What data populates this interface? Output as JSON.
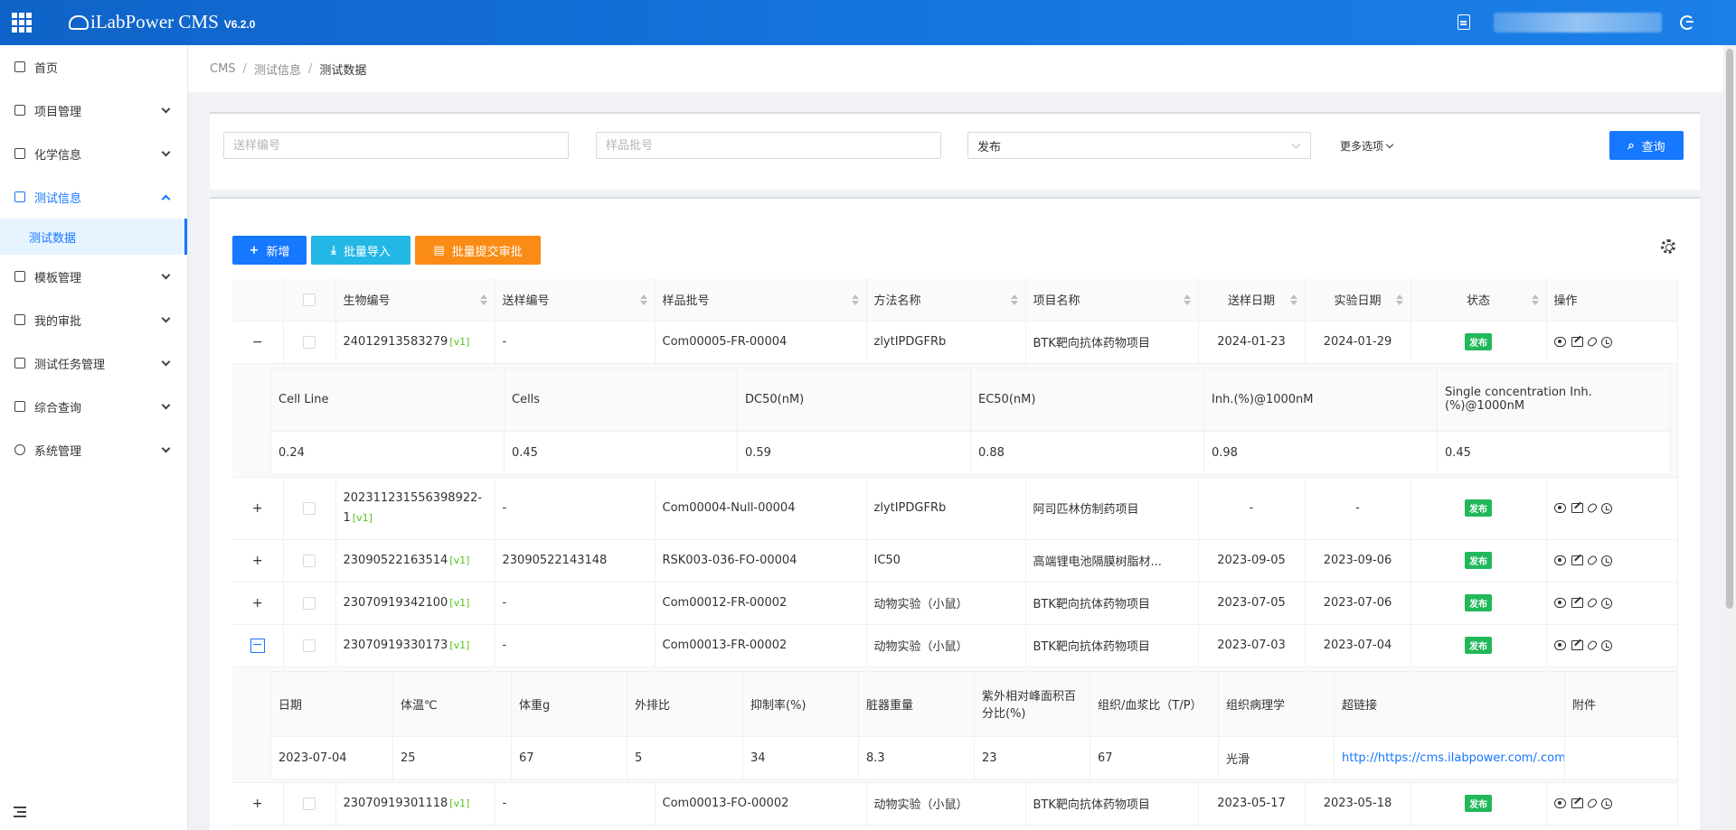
{
  "header": {
    "brand": "iLabPower CMS",
    "version": "V6.2.0"
  },
  "sidebar": {
    "items": [
      {
        "label": "首页"
      },
      {
        "label": "项目管理"
      },
      {
        "label": "化学信息"
      },
      {
        "label": "测试信息"
      },
      {
        "label": "模板管理"
      },
      {
        "label": "我的审批"
      },
      {
        "label": "测试任务管理"
      },
      {
        "label": "综合查询"
      },
      {
        "label": "系统管理"
      }
    ],
    "submenu_active": "测试数据"
  },
  "breadcrumb": {
    "root": "CMS",
    "parent": "测试信息",
    "current": "测试数据",
    "sep": "/"
  },
  "filters": {
    "sample_no_placeholder": "送样编号",
    "batch_no_placeholder": "样品批号",
    "status_value": "发布",
    "more_label": "更多选项",
    "query_label": "查询"
  },
  "toolbar": {
    "add_label": "新增",
    "import_label": "批量导入",
    "submit_label": "批量提交审批"
  },
  "table": {
    "columns": [
      "生物编号",
      "送样编号",
      "样品批号",
      "方法名称",
      "项目名称",
      "送样日期",
      "实验日期",
      "状态",
      "操作"
    ],
    "rows": [
      {
        "expander": "−",
        "bio_no": "24012913583279",
        "ver": "[v1]",
        "sample_no": "-",
        "batch": "Com00005-FR-00004",
        "method": "zlytIPDGFRb",
        "project": "BTK靶向抗体药物项目",
        "send_date": "2024-01-23",
        "exp_date": "2024-01-29",
        "status": "发布"
      },
      {
        "expander": "+",
        "bio_no": "202311231556398922-1",
        "ver": "[v1]",
        "sample_no": "-",
        "batch": "Com00004-Null-00004",
        "method": "zlytIPDGFRb",
        "project": "阿司匹林仿制药项目",
        "send_date": "-",
        "exp_date": "-",
        "status": "发布"
      },
      {
        "expander": "+",
        "bio_no": "23090522163514",
        "ver": "[v1]",
        "sample_no": "23090522143148",
        "batch": "RSK003-036-FO-00004",
        "method": "IC50",
        "project": "高端锂电池隔膜树脂材...",
        "send_date": "2023-09-05",
        "exp_date": "2023-09-06",
        "status": "发布"
      },
      {
        "expander": "+",
        "bio_no": "23070919342100",
        "ver": "[v1]",
        "sample_no": "-",
        "batch": "Com00012-FR-00002",
        "method": "动物实验（小鼠）",
        "project": "BTK靶向抗体药物项目",
        "send_date": "2023-07-05",
        "exp_date": "2023-07-06",
        "status": "发布"
      },
      {
        "expander": "−",
        "bio_no": "23070919330173",
        "ver": "[v1]",
        "sample_no": "-",
        "batch": "Com00013-FR-00002",
        "method": "动物实验（小鼠）",
        "project": "BTK靶向抗体药物项目",
        "send_date": "2023-07-03",
        "exp_date": "2023-07-04",
        "status": "发布"
      },
      {
        "expander": "+",
        "bio_no": "23070919301118",
        "ver": "[v1]",
        "sample_no": "-",
        "batch": "Com00013-FO-00002",
        "method": "动物实验（小鼠）",
        "project": "BTK靶向抗体药物项目",
        "send_date": "2023-05-17",
        "exp_date": "2023-05-18",
        "status": "发布"
      }
    ]
  },
  "detail1": {
    "headers": [
      "Cell Line",
      "Cells",
      "DC50(nM)",
      "EC50(nM)",
      "Inh.(%)@1000nM",
      "Single concentration Inh.(%)@1000nM"
    ],
    "values": [
      "0.24",
      "0.45",
      "0.59",
      "0.88",
      "0.98",
      "0.45"
    ]
  },
  "detail2": {
    "headers": [
      "日期",
      "体温℃",
      "体重g",
      "外排比",
      "抑制率(%)",
      "脏器重量",
      "紫外相对峰面积百分比(%)",
      "组织/血浆比（T/P）",
      "组织病理学",
      "超链接",
      "附件"
    ],
    "values": [
      "2023-07-04",
      "25",
      "67",
      "5",
      "34",
      "8.3",
      "23",
      "67",
      "光滑",
      "http://https://cms.ilabpower.com/.com",
      ""
    ]
  }
}
